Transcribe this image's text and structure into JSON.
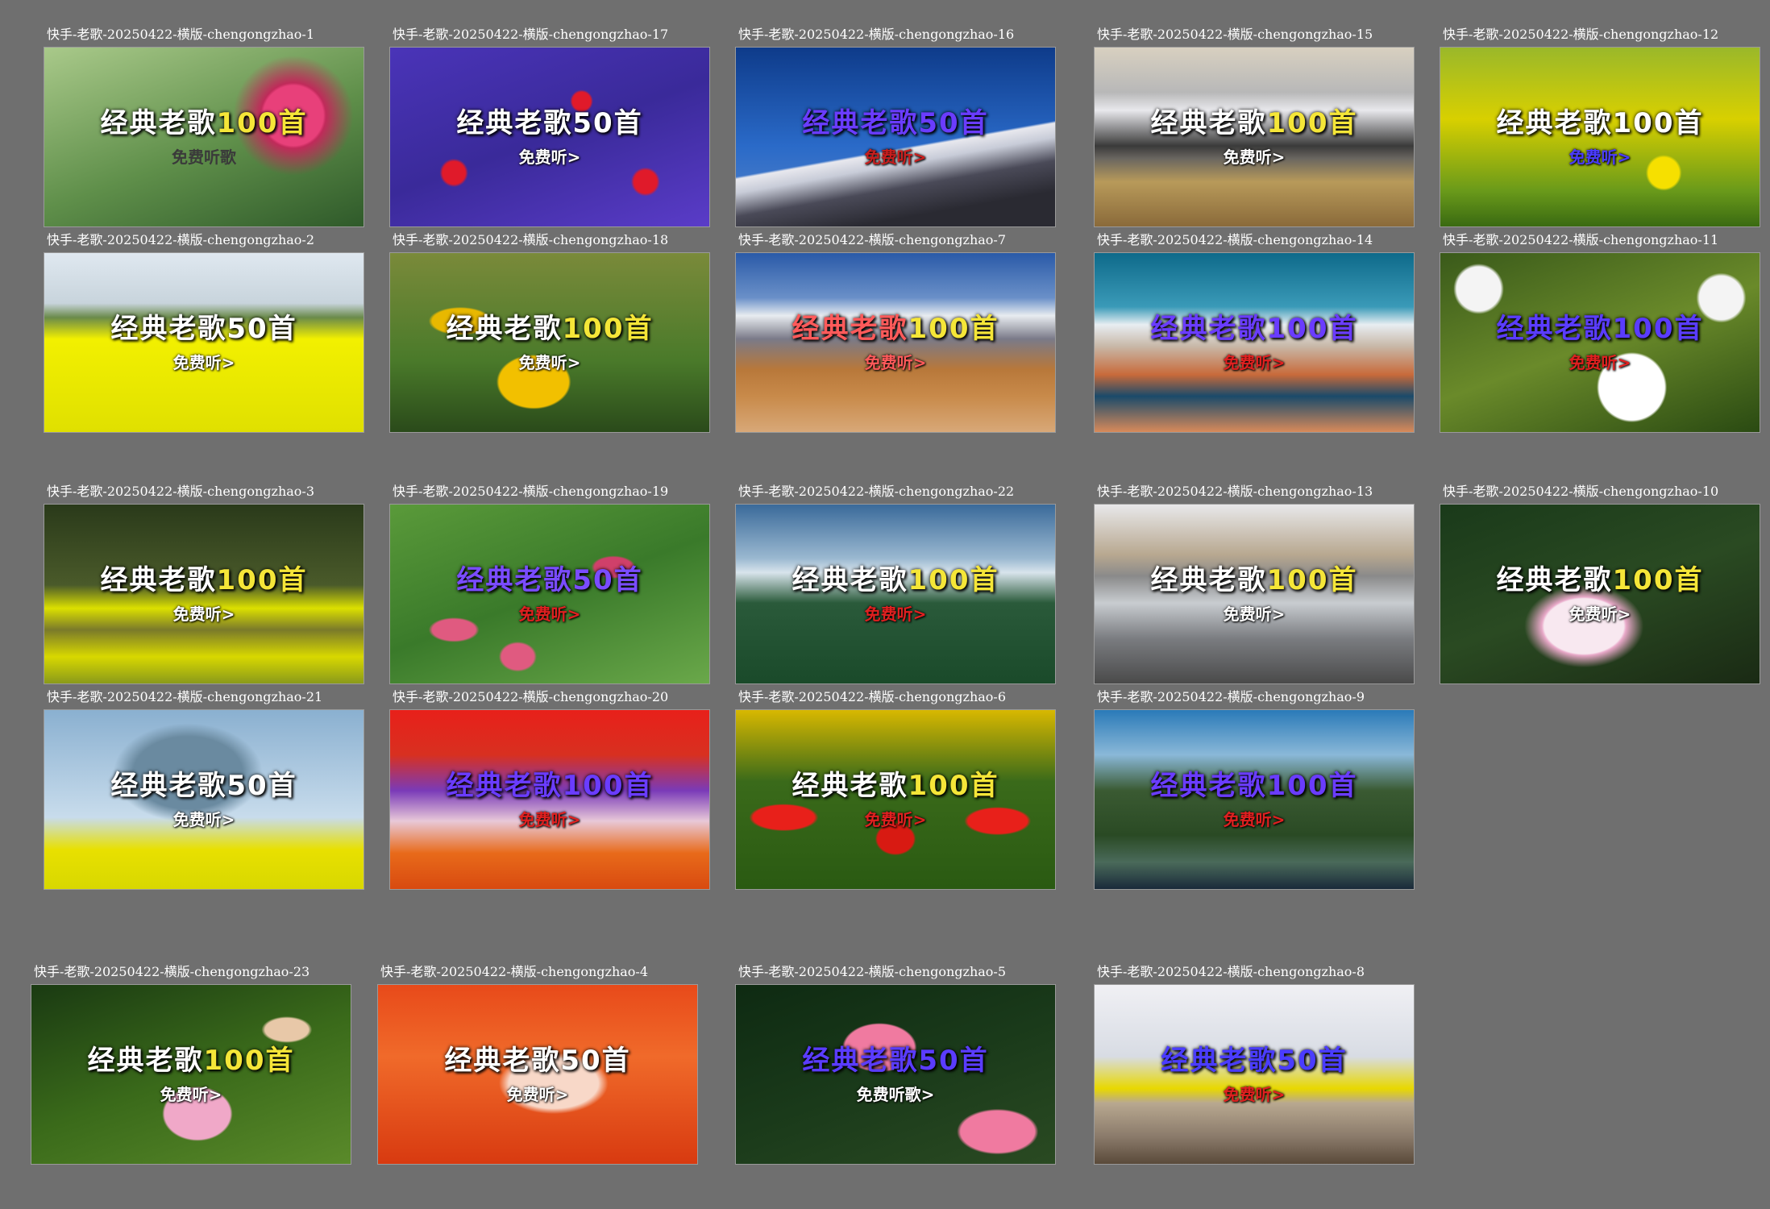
{
  "thumbnails": [
    {
      "caption": "快手-老歌-20250422-横版-chengongzhao-1",
      "title": "经典老歌",
      "number": "100首",
      "subtitle": "免费听歌",
      "title_color": "#ffffff",
      "number_color": "#f5e638",
      "subtitle_color": "#3a3a3a",
      "scene": "lotus-red"
    },
    {
      "caption": "快手-老歌-20250422-横版-chengongzhao-17",
      "title": "经典老歌",
      "number": "50首",
      "subtitle": "免费听>",
      "title_color": "#ffffff",
      "number_color": "#ffffff",
      "subtitle_color": "#ffffff",
      "scene": "flowers-purple-red"
    },
    {
      "caption": "快手-老歌-20250422-横版-chengongzhao-16",
      "title": "经典老歌",
      "number": "50首",
      "subtitle": "免费听>",
      "title_color": "#6a3cff",
      "number_color": "#6a3cff",
      "subtitle_color": "#c81e1e",
      "scene": "mountain-blue"
    },
    {
      "caption": "快手-老歌-20250422-横版-chengongzhao-15",
      "title": "经典老歌",
      "number": "100首",
      "subtitle": "免费听>",
      "title_color": "#ffffff",
      "number_color": "#f5e638",
      "subtitle_color": "#ffffff",
      "scene": "mountain-plain"
    },
    {
      "caption": "快手-老歌-20250422-横版-chengongzhao-12",
      "title": "经典老歌",
      "number": "100首",
      "subtitle": "免费听>",
      "title_color": "#ffffff",
      "number_color": "#ffffff",
      "subtitle_color": "#4a3cff",
      "scene": "rapeseed"
    },
    {
      "caption": "快手-老歌-20250422-横版-chengongzhao-2",
      "title": "经典老歌",
      "number": "50首",
      "subtitle": "免费听>",
      "title_color": "#ffffff",
      "number_color": "#ffffff",
      "subtitle_color": "#ffffff",
      "scene": "rapeseed-field"
    },
    {
      "caption": "快手-老歌-20250422-横版-chengongzhao-18",
      "title": "经典老歌",
      "number": "100首",
      "subtitle": "免费听>",
      "title_color": "#ffffff",
      "number_color": "#f5e638",
      "subtitle_color": "#ffffff",
      "scene": "tulip-yellow"
    },
    {
      "caption": "快手-老歌-20250422-横版-chengongzhao-7",
      "title": "经典老歌",
      "number": "100首",
      "subtitle": "免费听>",
      "title_color": "#ff5a5a",
      "number_color": "#f5e638",
      "subtitle_color": "#ff5a5a",
      "scene": "mountain-desert"
    },
    {
      "caption": "快手-老歌-20250422-横版-chengongzhao-14",
      "title": "经典老歌",
      "number": "100首",
      "subtitle": "免费听>",
      "title_color": "#6a3cff",
      "number_color": "#6a3cff",
      "subtitle_color": "#e02020",
      "scene": "lake-teal"
    },
    {
      "caption": "快手-老歌-20250422-横版-chengongzhao-11",
      "title": "经典老歌",
      "number": "100首",
      "subtitle": "免费听>",
      "title_color": "#5a3cff",
      "number_color": "#5a3cff",
      "subtitle_color": "#e02020",
      "scene": "peony-white"
    },
    {
      "caption": "快手-老歌-20250422-横版-chengongzhao-3",
      "title": "经典老歌",
      "number": "100首",
      "subtitle": "免费听>",
      "title_color": "#ffffff",
      "number_color": "#f5e638",
      "subtitle_color": "#ffffff",
      "scene": "forest-rapeseed"
    },
    {
      "caption": "快手-老歌-20250422-横版-chengongzhao-19",
      "title": "经典老歌",
      "number": "50首",
      "subtitle": "免费听>",
      "title_color": "#7a4cff",
      "number_color": "#7a4cff",
      "subtitle_color": "#e02020",
      "scene": "tulip-pink"
    },
    {
      "caption": "快手-老歌-20250422-横版-chengongzhao-22",
      "title": "经典老歌",
      "number": "100首",
      "subtitle": "免费听>",
      "title_color": "#ffffff",
      "number_color": "#f5e638",
      "subtitle_color": "#e02020",
      "scene": "pine-mountain"
    },
    {
      "caption": "快手-老歌-20250422-横版-chengongzhao-13",
      "title": "经典老歌",
      "number": "100首",
      "subtitle": "免费听>",
      "title_color": "#ffffff",
      "number_color": "#f5e638",
      "subtitle_color": "#ffffff",
      "scene": "lake-rocks"
    },
    {
      "caption": "快手-老歌-20250422-横版-chengongzhao-10",
      "title": "经典老歌",
      "number": "100首",
      "subtitle": "免费听>",
      "title_color": "#ffffff",
      "number_color": "#f5e638",
      "subtitle_color": "#ffffff",
      "scene": "lotus-white"
    },
    {
      "caption": "快手-老歌-20250422-横版-chengongzhao-21",
      "title": "经典老歌",
      "number": "50首",
      "subtitle": "免费听>",
      "title_color": "#ffffff",
      "number_color": "#ffffff",
      "subtitle_color": "#ffffff",
      "scene": "sky-rapeseed"
    },
    {
      "caption": "快手-老歌-20250422-横版-chengongzhao-20",
      "title": "经典老歌",
      "number": "100首",
      "subtitle": "免费听>",
      "title_color": "#6a3cff",
      "number_color": "#6a3cff",
      "subtitle_color": "#e02020",
      "scene": "tulip-mixed"
    },
    {
      "caption": "快手-老歌-20250422-横版-chengongzhao-6",
      "title": "经典老歌",
      "number": "100首",
      "subtitle": "免费听>",
      "title_color": "#ffffff",
      "number_color": "#f5e638",
      "subtitle_color": "#e02020",
      "scene": "tulip-red"
    },
    {
      "caption": "快手-老歌-20250422-横版-chengongzhao-9",
      "title": "经典老歌",
      "number": "100首",
      "subtitle": "免费听>",
      "title_color": "#6a3cff",
      "number_color": "#6a3cff",
      "subtitle_color": "#e02020",
      "scene": "canyon"
    },
    {
      "caption": "快手-老歌-20250422-横版-chengongzhao-23",
      "title": "经典老歌",
      "number": "100首",
      "subtitle": "免费听>",
      "title_color": "#ffffff",
      "number_color": "#f5e638",
      "subtitle_color": "#ffffff",
      "scene": "lotus-pink"
    },
    {
      "caption": "快手-老歌-20250422-横版-chengongzhao-4",
      "title": "经典老歌",
      "number": "50首",
      "subtitle": "免费听>",
      "title_color": "#ffffff",
      "number_color": "#ffffff",
      "subtitle_color": "#ffffff",
      "scene": "tulip-orange"
    },
    {
      "caption": "快手-老歌-20250422-横版-chengongzhao-5",
      "title": "经典老歌",
      "number": "50首",
      "subtitle": "免费听歌>",
      "title_color": "#5a3cff",
      "number_color": "#5a3cff",
      "subtitle_color": "#ffffff",
      "scene": "tulip-dark"
    },
    {
      "caption": "快手-老歌-20250422-横版-chengongzhao-8",
      "title": "经典老歌",
      "number": "50首",
      "subtitle": "免费听>",
      "title_color": "#4a3cff",
      "number_color": "#4a3cff",
      "subtitle_color": "#e02020",
      "scene": "reeds-winter"
    }
  ]
}
